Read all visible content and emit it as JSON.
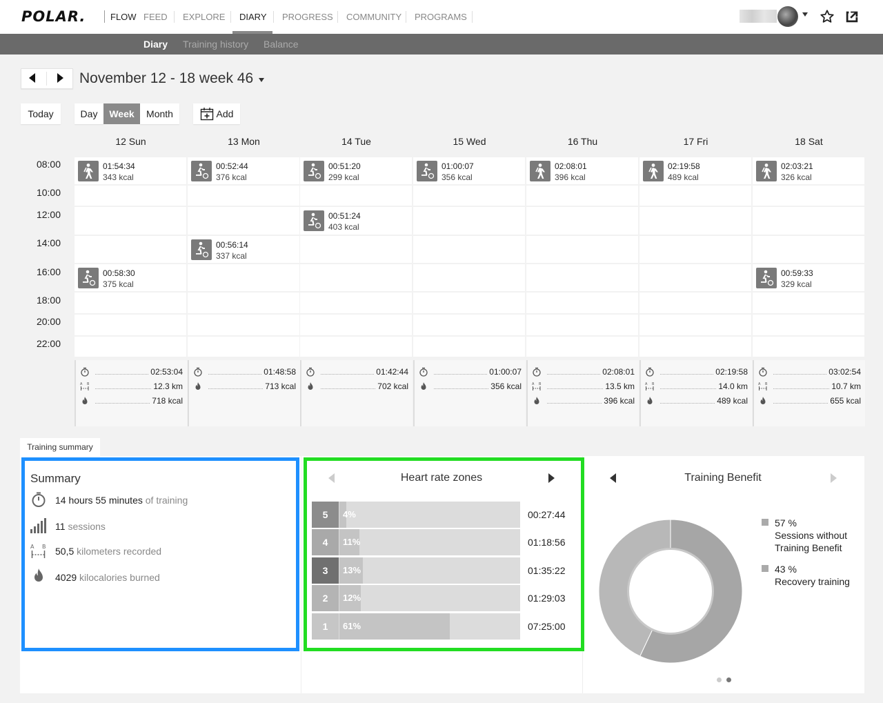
{
  "nav": {
    "logo": "POLAR.",
    "items": [
      "FLOW",
      "FEED",
      "EXPLORE",
      "DIARY",
      "PROGRESS",
      "COMMUNITY",
      "PROGRAMS"
    ]
  },
  "subnav": {
    "items": [
      "Diary",
      "Training history",
      "Balance"
    ]
  },
  "week": {
    "title": "November 12 - 18 week 46"
  },
  "views": {
    "today": "Today",
    "day": "Day",
    "week": "Week",
    "month": "Month",
    "add": "Add"
  },
  "days": [
    "12 Sun",
    "13 Mon",
    "14 Tue",
    "15 Wed",
    "16 Thu",
    "17 Fri",
    "18 Sat"
  ],
  "times": [
    "08:00",
    "10:00",
    "12:00",
    "14:00",
    "16:00",
    "18:00",
    "20:00",
    "22:00"
  ],
  "entries": [
    {
      "day": 0,
      "slot": 0,
      "sport": "walking-icon",
      "time": "01:54:34",
      "kcal": "343 kcal"
    },
    {
      "day": 1,
      "slot": 0,
      "sport": "cycling-icon",
      "time": "00:52:44",
      "kcal": "376 kcal"
    },
    {
      "day": 2,
      "slot": 0,
      "sport": "cycling-icon",
      "time": "00:51:20",
      "kcal": "299 kcal"
    },
    {
      "day": 3,
      "slot": 0,
      "sport": "cycling-icon",
      "time": "01:00:07",
      "kcal": "356 kcal"
    },
    {
      "day": 4,
      "slot": 0,
      "sport": "walking-icon",
      "time": "02:08:01",
      "kcal": "396 kcal"
    },
    {
      "day": 5,
      "slot": 0,
      "sport": "walking-icon",
      "time": "02:19:58",
      "kcal": "489 kcal"
    },
    {
      "day": 6,
      "slot": 0,
      "sport": "walking-icon",
      "time": "02:03:21",
      "kcal": "326 kcal"
    },
    {
      "day": 2,
      "slot": 2,
      "sport": "cycling-icon",
      "time": "00:51:24",
      "kcal": "403 kcal"
    },
    {
      "day": 1,
      "slot": 3,
      "sport": "cycling-icon",
      "time": "00:56:14",
      "kcal": "337 kcal"
    },
    {
      "day": 0,
      "slot": 4,
      "sport": "cycling-icon",
      "time": "00:58:30",
      "kcal": "375 kcal"
    },
    {
      "day": 6,
      "slot": 4,
      "sport": "cycling-icon",
      "time": "00:59:33",
      "kcal": "329 kcal"
    }
  ],
  "day_summaries": [
    {
      "duration": "02:53:04",
      "distance": "12.3 km",
      "kcal": "718 kcal"
    },
    {
      "duration": "01:48:58",
      "distance": "",
      "kcal": "713 kcal"
    },
    {
      "duration": "01:42:44",
      "distance": "",
      "kcal": "702 kcal"
    },
    {
      "duration": "01:00:07",
      "distance": "",
      "kcal": "356 kcal"
    },
    {
      "duration": "02:08:01",
      "distance": "13.5 km",
      "kcal": "396 kcal"
    },
    {
      "duration": "02:19:58",
      "distance": "14.0 km",
      "kcal": "489 kcal"
    },
    {
      "duration": "03:02:54",
      "distance": "10.7 km",
      "kcal": "655 kcal"
    }
  ],
  "training_summary": {
    "tab": "Training summary",
    "summary": {
      "title": "Summary",
      "training_value": "14 hours 55 minutes",
      "training_label": "of training",
      "sessions_value": "11",
      "sessions_label": "sessions",
      "km_value": "50,5",
      "km_label": "kilometers recorded",
      "kcal_value": "4029",
      "kcal_label": "kilocalories burned"
    },
    "hr_zones": {
      "title": "Heart rate zones",
      "zones": [
        {
          "zone": "5",
          "percent": "4%",
          "fraction": 0.04,
          "time": "00:27:44",
          "color": "#8c8c8c"
        },
        {
          "zone": "4",
          "percent": "11%",
          "fraction": 0.11,
          "time": "01:18:56",
          "color": "#a9a9a9"
        },
        {
          "zone": "3",
          "percent": "13%",
          "fraction": 0.13,
          "time": "01:35:22",
          "color": "#707070"
        },
        {
          "zone": "2",
          "percent": "12%",
          "fraction": 0.12,
          "time": "01:29:03",
          "color": "#b4b4b4"
        },
        {
          "zone": "1",
          "percent": "61%",
          "fraction": 0.61,
          "time": "07:25:00",
          "color": "#c6c6c6"
        }
      ]
    },
    "training_benefit": {
      "title": "Training Benefit",
      "items": [
        {
          "percent": "57 %",
          "label": "Sessions without Training Benefit",
          "fraction": 0.57
        },
        {
          "percent": "43 %",
          "label": "Recovery training",
          "fraction": 0.43
        }
      ]
    }
  }
}
